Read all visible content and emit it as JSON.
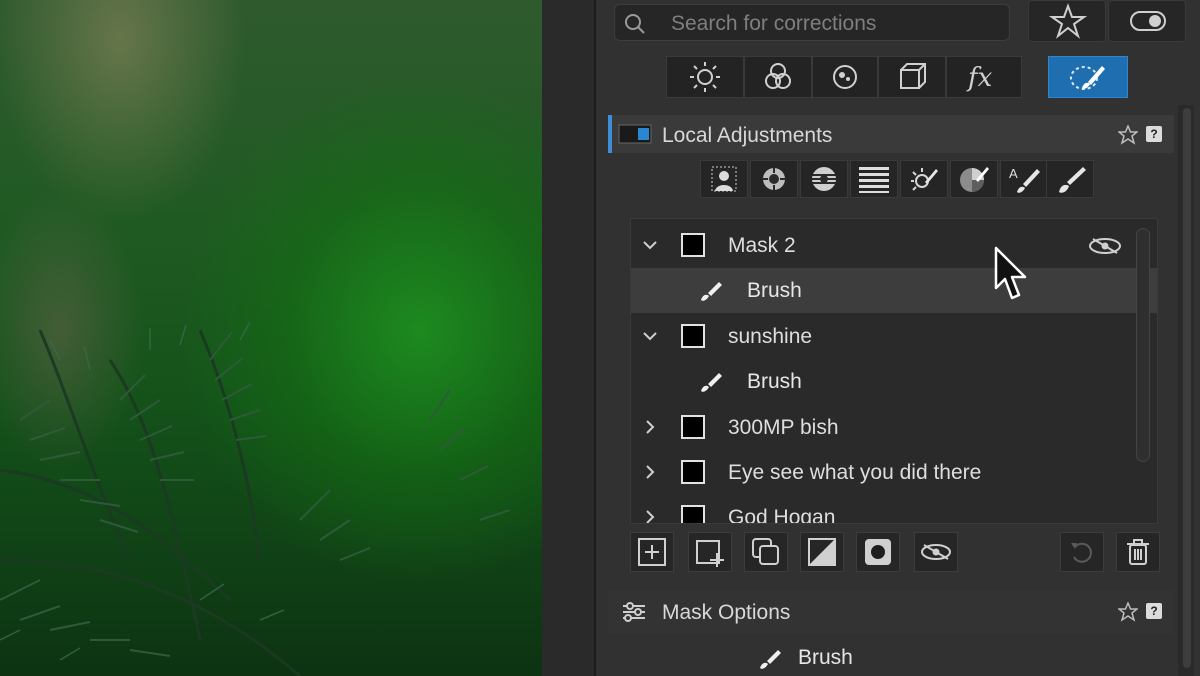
{
  "search": {
    "placeholder": "Search for corrections"
  },
  "palette_tabs": [
    {
      "icon": "sun-icon"
    },
    {
      "icon": "color-circles-icon"
    },
    {
      "icon": "detail-dots-icon"
    },
    {
      "icon": "cube-icon"
    },
    {
      "icon": "fx-icon",
      "label": "fx"
    },
    {
      "icon": "local-adjust-brush-icon",
      "active": true
    }
  ],
  "local_adjustments": {
    "title": "Local Adjustments",
    "help_label": "?",
    "tools": [
      "person-mask-icon",
      "control-point-icon",
      "luminance-mask-icon",
      "graduated-filter-icon",
      "auto-mask-icon",
      "color-picker-icon",
      "auto-brush-icon",
      "brush-icon"
    ],
    "masks": [
      {
        "name": "Mask 2",
        "expanded": true,
        "children": [
          {
            "name": "Brush",
            "selected": true
          }
        ],
        "visible_toggle": true
      },
      {
        "name": "sunshine",
        "expanded": true,
        "children": [
          {
            "name": "Brush"
          }
        ]
      },
      {
        "name": "300MP bish",
        "expanded": false
      },
      {
        "name": "Eye see what you did there",
        "expanded": false
      },
      {
        "name": "God Hogan",
        "expanded": false
      }
    ],
    "bottom_tools": [
      "add-mask-icon",
      "add-mask-copy-icon",
      "duplicate-mask-icon",
      "invert-mask-icon",
      "mask-fill-icon",
      "hide-mask-icon"
    ],
    "right_tools": [
      "reset-icon",
      "trash-icon"
    ]
  },
  "mask_options": {
    "title": "Mask Options",
    "help_label": "?",
    "brush_label": "Brush"
  },
  "colors": {
    "accent": "#1f6fb0",
    "panel": "#313131",
    "header": "#3a3a3a"
  }
}
